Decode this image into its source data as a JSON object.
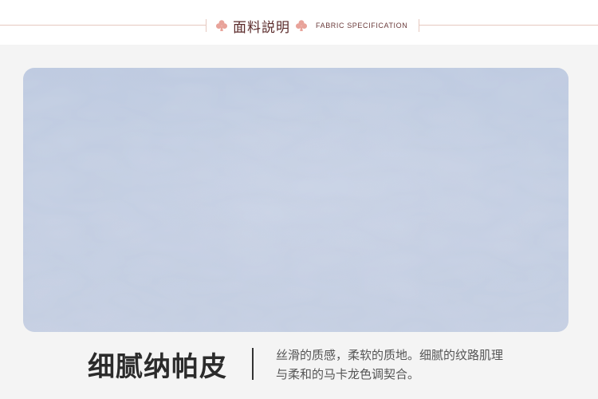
{
  "header": {
    "title_cn": "面料説明",
    "title_en": "FABRIC SPECIFICATION",
    "icon": "club-icon",
    "accent_color": "#e8a39a",
    "line_color": "#e6c9c0"
  },
  "swatch": {
    "color": "#c2cde2",
    "texture": "fine leather grain"
  },
  "caption": {
    "name": "细腻纳帕皮",
    "description_line1": "丝滑的质感，柔软的质地。细腻的纹路肌理",
    "description_line2": "与柔和的马卡龙色调契合。"
  }
}
